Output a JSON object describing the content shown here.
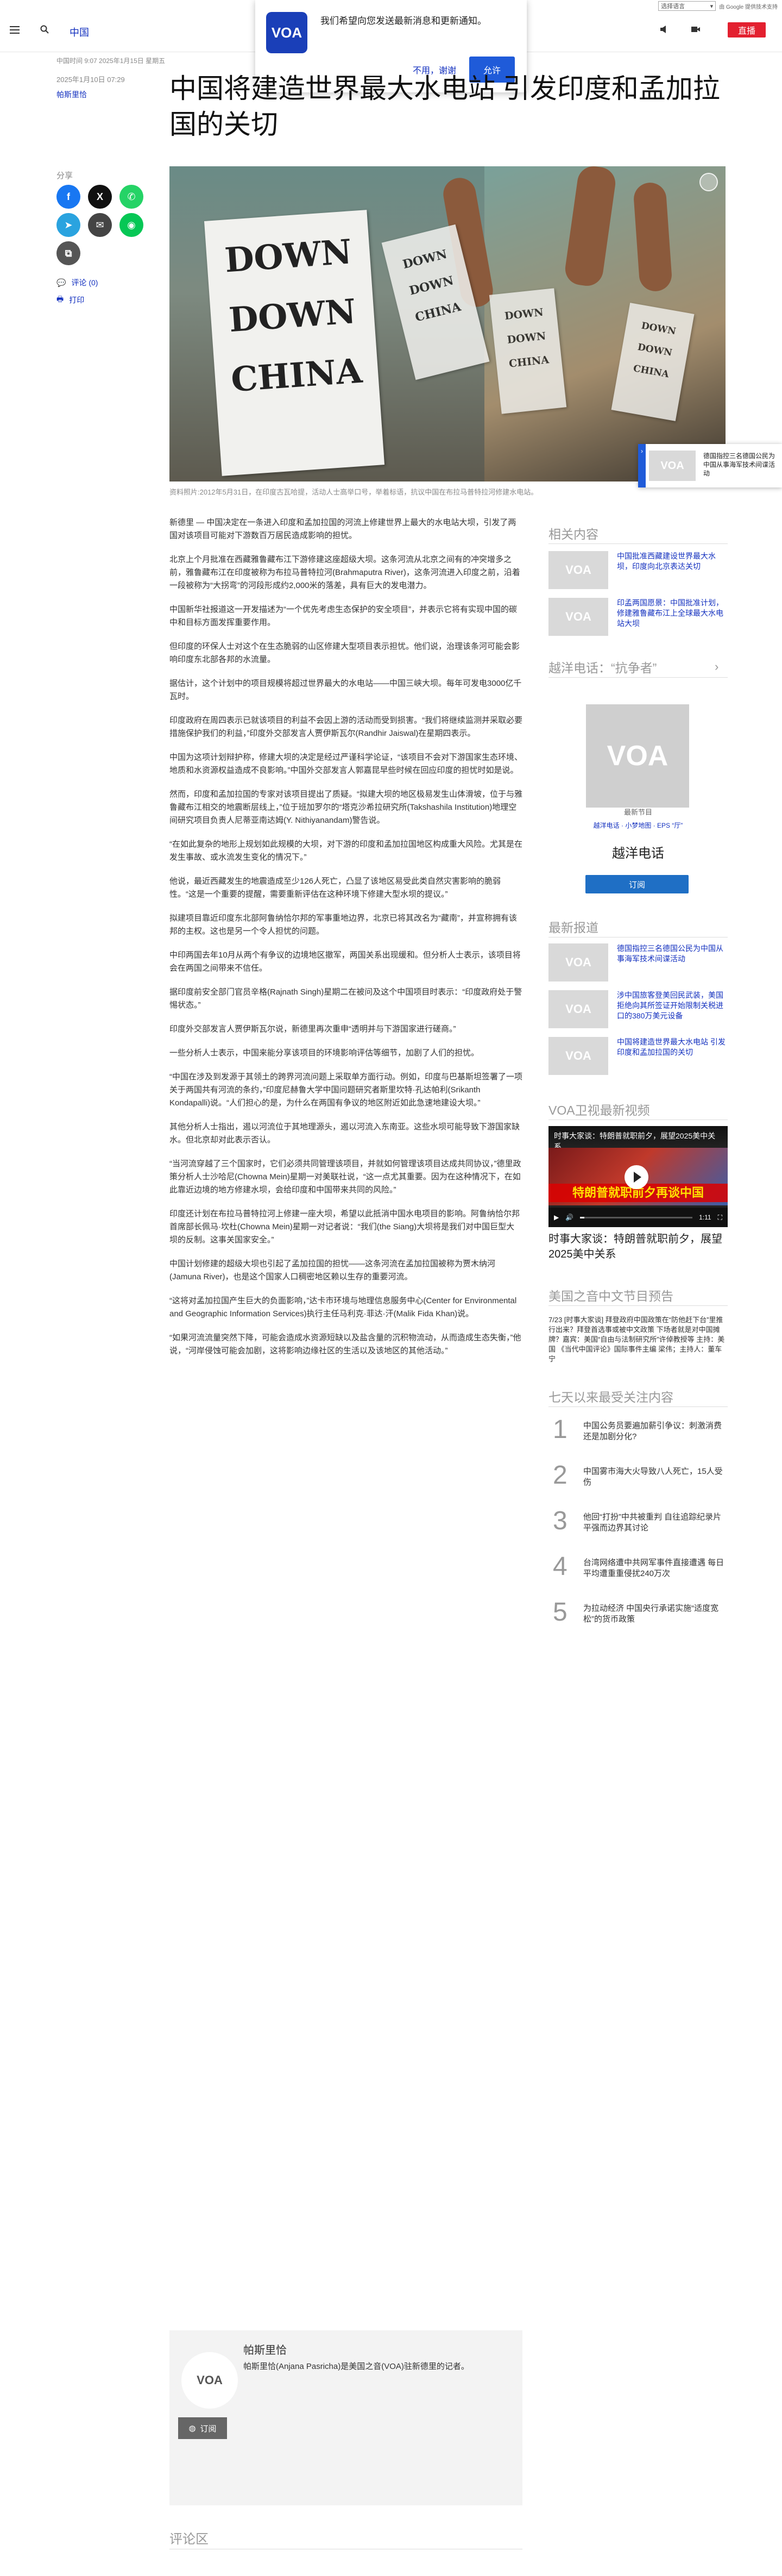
{
  "translate": {
    "select_label": "选择语言",
    "powered": "由 Google 提供技术支持"
  },
  "header": {
    "section": "中国",
    "live_label": "直播"
  },
  "notification": {
    "message": "我们希望向您发送最新消息和更新通知。",
    "cancel_label": "不用，谢谢",
    "allow_label": "允许",
    "logo_text": "VOA"
  },
  "article": {
    "meta_line": "中国时间 9:07 2025年1月15日 星期五",
    "date": "2025年1月10日 07:29",
    "author": "帕斯里恰",
    "headline": "中国将建造世界最大水电站 引发印度和孟加拉国的关切",
    "caption": "资料照片:2012年5月31日，在印度古瓦哈提，活动人士高举口号，举着标语，抗议中国在布拉马普特拉河修建水电站。",
    "paragraphs": [
      "新德里 — 中国决定在一条进入印度和孟加拉国的河流上修建世界上最大的水电站大坝，引发了两国对该项目可能对下游数百万居民造成影响的担忧。",
      "北京上个月批准在西藏雅鲁藏布江下游修建这座超级大坝。这条河流从北京之间有的冲突增多之前，雅鲁藏布江在印度被称为布拉马普特拉河(Brahmaputra River)，这条河流进入印度之前，沿着一段被称为“大拐弯”的河段形成约2,000米的落差，具有巨大的发电潜力。",
      "中国新华社报道这一开发描述为“一个优先考虑生态保护的安全项目”，并表示它将有实现中国的碳中和目标方面发挥重要作用。",
      "但印度的环保人士对这个在生态脆弱的山区修建大型项目表示担忧。他们说，治理该条河可能会影响印度东北部各邦的水流量。",
      "据估计，这个计划中的项目规模将超过世界最大的水电站——中国三峡大坝。每年可发电3000亿千瓦时。",
      "印度政府在周四表示已就该项目的利益不会因上游的活动而受到损害。“我们将继续监测并采取必要措施保护我们的利益，”印度外交部发言人贾伊斯瓦尔(Randhir Jaiswal)在星期四表示。",
      "中国为这项计划辩护称，修建大坝的决定是经过严谨科学论证，“该项目不会对下游国家生态环境、地质和水资源权益造成不良影响。”中国外交部发言人郭嘉昆早些时候在回应印度的担忧时如是说。",
      "然而，印度和孟加拉国的专家对该项目提出了质疑。“拟建大坝的地区极易发生山体滑坡，位于与雅鲁藏布江相交的地震断层线上，”位于班加罗尔的“塔克沙希拉研究所(Takshashila Institution)地理空间研究项目负责人尼蒂亚南达姆(Y. Nithiyanandam)警告说。",
      "“在如此复杂的地形上规划如此规模的大坝，对下游的印度和孟加拉国地区构成重大风险。尤其是在发生事故、或水流发生变化的情况下。”",
      "他说，最近西藏发生的地震造成至少126人死亡，凸显了该地区易受此类自然灾害影响的脆弱性。“这是一个重要的提醒，需要重新评估在这种环境下修建大型水坝的提议。”",
      "拟建项目靠近印度东北部阿鲁纳恰尔邦的军事重地边界，北京已将其改名为“藏南”，并宣称拥有该邦的主权。这也是另一个令人担忧的问题。",
      "中印两国去年10月从两个有争议的边境地区撤军，两国关系出现缓和。但分析人士表示，该项目将会在两国之间带来不信任。",
      "据印度前安全部门官员辛格(Rajnath Singh)星期二在被问及这个中国项目时表示：“印度政府处于警惕状态。”",
      "印度外交部发言人贾伊斯瓦尔说，新德里再次重申“透明并与下游国家进行磋商。”",
      "一些分析人士表示，中国来能分享该项目的环境影响评估等细节，加剧了人们的担忧。",
      "“中国在涉及到发源于其领土的跨界河流问题上采取单方面行动。例如，印度与巴基斯坦签署了一项关于两国共有河流的条约，”印度尼赫鲁大学中国问题研究者斯里坎特·孔达帕利(Srikanth Kondapalli)说。“人们担心的是，为什么在两国有争议的地区附近如此急速地建设大坝。”",
      "其他分析人士指出，遏以河流位于其地理源头，遏以河流入东南亚。这些水坝可能导致下游国家缺水。但北京却对此表示否认。",
      "“当河流穿越了三个国家时，它们必须共同管理该项目，并就如何管理该项目达成共同协议，”德里政策分析人士沙哈尼(Chowna Mein)星期一对美联社说，“这一点尤其重要。因为在这种情况下，在如此靠近边境的地方修建水坝，会给印度和中国带来共同的风险。”",
      "印度还计划在布拉马普特拉河上修建一座大坝，希望以此抵消中国水电项目的影响。阿鲁纳恰尔邦首席部长佩马·坎杜(Chowna Mein)星期一对记者说：“我们(the Siang)大坝将是我们对中国巨型大坝的反制。这事关国家安全。”",
      "中国计划修建的超级大坝也引起了孟加拉国的担忧——这条河流在孟加拉国被称为贾木纳河(Jamuna River)，也是这个国家人口稠密地区赖以生存的重要河流。",
      "“这将对孟加拉国产生巨大的负面影响，”达卡市环境与地理信息服务中心(Center for Environmental and Geographic Information Services)执行主任马利克·菲达·汗(Malik Fida Khan)说。",
      "“如果河流流量突然下降，可能会造成水资源短缺以及盐含量的沉积物流动，从而造成生态失衡，”他说，“河岸侵蚀可能会加剧，这将影响边缘社区的生活以及该地区的其他活动。”"
    ]
  },
  "share": {
    "label": "分享",
    "comments_label": "评论 (0)",
    "print_label": "打印"
  },
  "author_box": {
    "name": "帕斯里恰",
    "bio": "帕斯里恰(Anjana Pasricha)是美国之音(VOA)驻新德里的记者。",
    "subscribe_label": "订阅",
    "avatar_text": "VOA"
  },
  "comments_title": "评论区",
  "sidebar": {
    "related_title": "相关内容",
    "related": [
      "中国批准西藏建设世界最大水坝，印度向北京表达关切",
      "印孟两国愿景：中国批准计划，修建雅鲁藏布江上全球最大水电站大坝"
    ],
    "program_title": "越洋电话：“抗争者”",
    "program_cap": "最新节目",
    "program_links": "越洋电话 · 小梦地图 · EPS “厅”",
    "program_name": "越洋电话",
    "program_subscribe": "订阅",
    "latest_title": "最新报道",
    "latest": [
      "德国指控三名德国公民为中国从事海军技术间谍活动",
      "涉中国旅客登美回民武装，美国拒绝向其所签证开始限制关税进口的380万美元设备",
      "中国将建造世界最大水电站 引发印度和孟加拉国的关切"
    ],
    "video_title_section": "VOA卫视最新视频",
    "video_overlay": "时事大家谈：特朗普就职前夕，展望2025美中关系",
    "video_badge": "特朗普就职前夕再谈中国",
    "video_time": "1:11",
    "video_caption": "时事大家谈：特朗普就职前夕，展望2025美中关系",
    "schedule_title": "美国之音中文节目预告",
    "schedule": "7/23 [时事大家谈] 拜登政府中国政策在“防他赶下台”里推行出来？拜登首选事或被中文政策 下场者就是对中国摊牌？嘉宾：美国“自由与法制研究所”许倬教授等 主持：美国 《当代中国评论》国际事件主编 梁伟；主持人：董车宁",
    "popular_title": "七天以来最受关注内容",
    "popular": [
      {
        "num": "1",
        "text": "中国公务员要遍加薪引争议：刺激消费还是加剧分化?"
      },
      {
        "num": "2",
        "text": "中国雾市海大火导致八人死亡，15人受伤"
      },
      {
        "num": "3",
        "text": "他回“打扮”中共被重判 自往追踪纪录片平强而边界其讨论"
      },
      {
        "num": "4",
        "text": "台湾网络遭中共网军事件直接遭遇 每日平均遭重重侵扰240万次"
      },
      {
        "num": "5",
        "text": "为拉动经济 中国央行承诺实施“适度宽松”的货币政策"
      }
    ]
  },
  "colors": {
    "brand_blue": "#1330bf",
    "live_red": "#e3202f",
    "accent_blue": "#1f5bd9"
  }
}
